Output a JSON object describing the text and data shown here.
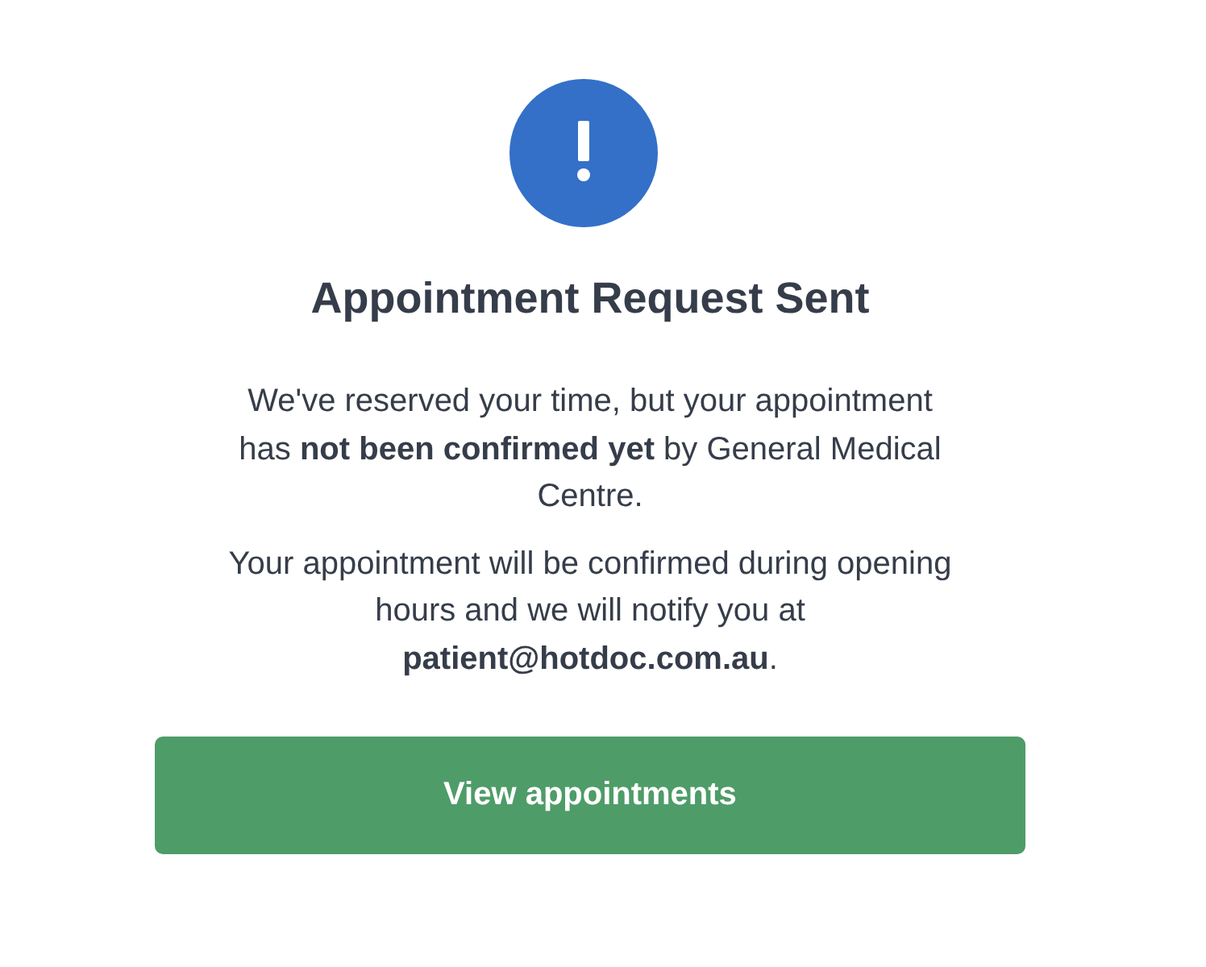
{
  "title": "Appointment Request Sent",
  "paragraphs": [
    "We've reserved your time, but your appointment has **not been confirmed yet** by General Medical Centre.",
    "Your appointment will be confirmed during opening hours and we will notify you at **patient@hotdoc.com.au**."
  ],
  "button": {
    "label": "View appointments"
  }
}
